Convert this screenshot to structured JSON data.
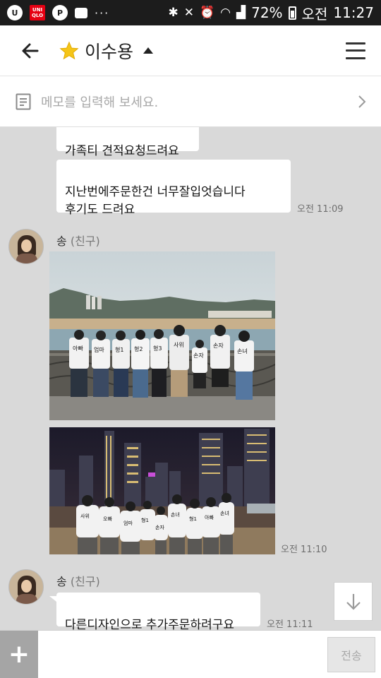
{
  "status_bar": {
    "uniqlo_icon_text": "UNI QLO",
    "p_icon_text": "P",
    "dots": "···",
    "battery": "72%",
    "ampm": "오전",
    "time": "11:27"
  },
  "header": {
    "title": "이수용"
  },
  "memo": {
    "placeholder": "메모를 입력해 보세요."
  },
  "messages": [
    {
      "text": "가족티 견적요청드려요"
    },
    {
      "text": "지난번에주문한건 너무잘입엇습니다\n후기도 드려요",
      "time": "오전 11:09"
    }
  ],
  "friend_group_1": {
    "sender_name": "송",
    "sender_rel": "(친구)",
    "time": "오전 11:10"
  },
  "friend_group_2": {
    "sender_name": "송",
    "sender_rel": "(친구)",
    "text": "다른디자인으로 추가주문하려구요",
    "time": "오전 11:11"
  },
  "photo1_shirts": [
    "아빠",
    "엄마",
    "형1",
    "형2",
    "형3",
    "사위",
    "손자",
    "손자",
    "손녀"
  ],
  "photo2_shirts": [
    "사위",
    "오빠",
    "엄마",
    "형1",
    "손자",
    "손녀",
    "형1",
    "아빠",
    "손녀"
  ],
  "input_bar": {
    "placeholder": "",
    "send_label": "전송"
  },
  "colors": {
    "chat_bg": "#d9d9d9",
    "star": "#f5c518",
    "status_bar": "#1c1c1c"
  }
}
